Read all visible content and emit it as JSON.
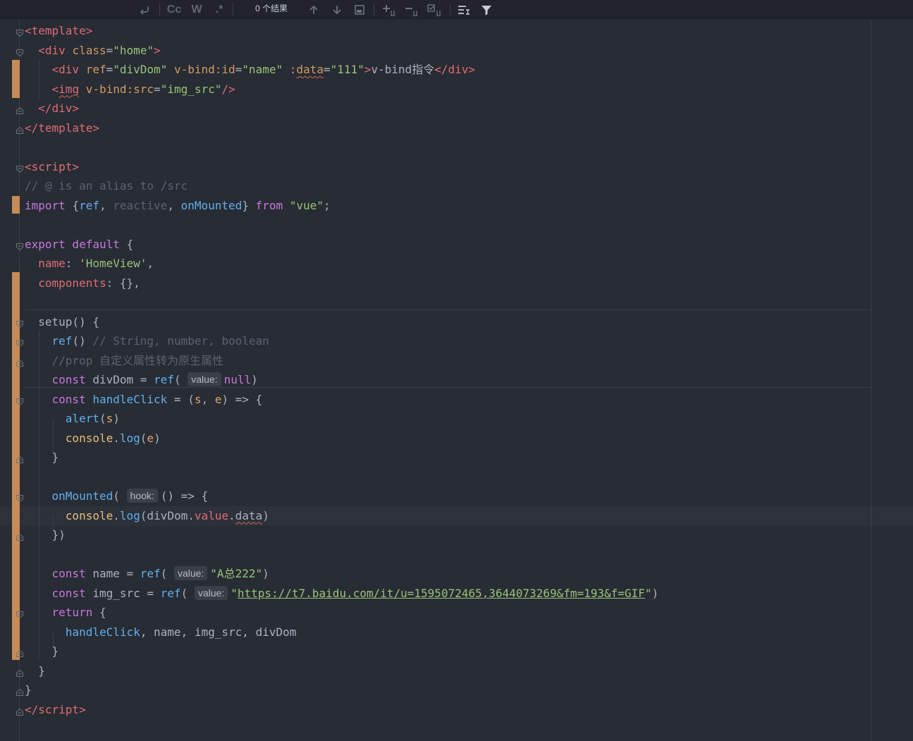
{
  "search": {
    "result_count": "0 个结果",
    "case_label": "Cc",
    "word_label": "W",
    "regex_label": ".*"
  },
  "code": [
    [
      [
        "tag",
        "<template>"
      ]
    ],
    [
      [
        "plain",
        "  "
      ],
      [
        "tag",
        "<div "
      ],
      [
        "attr",
        "class"
      ],
      [
        "plain",
        "="
      ],
      [
        "str",
        "\"home\""
      ],
      [
        "tag",
        ">"
      ]
    ],
    [
      [
        "plain",
        "    "
      ],
      [
        "tag",
        "<div "
      ],
      [
        "attr",
        "ref"
      ],
      [
        "plain",
        "="
      ],
      [
        "str",
        "\"divDom\" "
      ],
      [
        "attr",
        "v-bind:id"
      ],
      [
        "plain",
        "="
      ],
      [
        "str",
        "\"name\" "
      ],
      [
        "attr",
        ":"
      ],
      [
        "attr squig",
        "data"
      ],
      [
        "plain",
        "="
      ],
      [
        "str",
        "\"111\""
      ],
      [
        "tag",
        ">"
      ],
      [
        "plain",
        "v-bind指令"
      ],
      [
        "tag",
        "</div>"
      ]
    ],
    [
      [
        "plain",
        "    "
      ],
      [
        "tag",
        "<"
      ],
      [
        "tag squig",
        "img"
      ],
      [
        "tag",
        " "
      ],
      [
        "attr",
        "v-bind:src"
      ],
      [
        "plain",
        "="
      ],
      [
        "str",
        "\"img_src\""
      ],
      [
        "tag",
        "/>"
      ]
    ],
    [
      [
        "plain",
        "  "
      ],
      [
        "tag",
        "</div>"
      ]
    ],
    [
      [
        "tag",
        "</template>"
      ]
    ],
    [],
    [
      [
        "tag",
        "<script>"
      ]
    ],
    [
      [
        "cm",
        "// @ is an alias to /src"
      ]
    ],
    [
      [
        "kw",
        "import "
      ],
      [
        "plain",
        "{"
      ],
      [
        "fn",
        "ref"
      ],
      [
        "plain",
        ", "
      ],
      [
        "cm",
        "reactive"
      ],
      [
        "plain",
        ", "
      ],
      [
        "fn",
        "onMounted"
      ],
      [
        "plain",
        "} "
      ],
      [
        "kw",
        "from "
      ],
      [
        "str",
        "\"vue\""
      ],
      [
        "plain",
        ";"
      ]
    ],
    [],
    [
      [
        "kw",
        "export default "
      ],
      [
        "plain",
        "{"
      ]
    ],
    [
      [
        "plain",
        "  "
      ],
      [
        "tag",
        "name"
      ],
      [
        "plain",
        ": "
      ],
      [
        "str",
        "'HomeView'"
      ],
      [
        "plain",
        ","
      ]
    ],
    [
      [
        "plain",
        "  "
      ],
      [
        "tag",
        "components"
      ],
      [
        "plain",
        ": {},"
      ]
    ],
    [],
    [
      [
        "plain",
        "  setup() {"
      ]
    ],
    [
      [
        "plain",
        "    "
      ],
      [
        "fn",
        "ref"
      ],
      [
        "plain",
        "() "
      ],
      [
        "cm",
        "// String, number, boolean"
      ]
    ],
    [
      [
        "plain",
        "    "
      ],
      [
        "cm",
        "//prop 自定义属性转为原生属性"
      ]
    ],
    [
      [
        "plain",
        "    "
      ],
      [
        "kw",
        "const "
      ],
      [
        "plain",
        "divDom = "
      ],
      [
        "fn",
        "ref"
      ],
      [
        "plain",
        "( "
      ],
      [
        "hint",
        "value:"
      ],
      [
        "kw",
        "null"
      ],
      [
        "plain",
        ")"
      ]
    ],
    [
      [
        "plain",
        "    "
      ],
      [
        "kw",
        "const "
      ],
      [
        "fn",
        "handleClick"
      ],
      [
        "plain",
        " = ("
      ],
      [
        "param",
        "s"
      ],
      [
        "plain",
        ", "
      ],
      [
        "param",
        "e"
      ],
      [
        "plain",
        ") => {"
      ]
    ],
    [
      [
        "plain",
        "      "
      ],
      [
        "fn",
        "alert"
      ],
      [
        "plain",
        "("
      ],
      [
        "param",
        "s"
      ],
      [
        "plain",
        ")"
      ]
    ],
    [
      [
        "plain",
        "      "
      ],
      [
        "id",
        "console"
      ],
      [
        "plain",
        "."
      ],
      [
        "fn",
        "log"
      ],
      [
        "plain",
        "("
      ],
      [
        "param",
        "e"
      ],
      [
        "plain",
        ")"
      ]
    ],
    [
      [
        "plain",
        "    }"
      ]
    ],
    [],
    [
      [
        "plain",
        "    "
      ],
      [
        "fn",
        "onMounted"
      ],
      [
        "plain",
        "( "
      ],
      [
        "hint",
        "hook:"
      ],
      [
        "plain",
        "() => {"
      ]
    ],
    [
      [
        "plain",
        "      "
      ],
      [
        "id",
        "console"
      ],
      [
        "plain",
        "."
      ],
      [
        "fn",
        "log"
      ],
      [
        "plain",
        "(divDom."
      ],
      [
        "tag",
        "value"
      ],
      [
        "plain",
        "."
      ],
      [
        "plain squig",
        "data"
      ],
      [
        "plain",
        ")"
      ]
    ],
    [
      [
        "plain",
        "    })"
      ]
    ],
    [],
    [
      [
        "plain",
        "    "
      ],
      [
        "kw",
        "const "
      ],
      [
        "plain",
        "name = "
      ],
      [
        "fn",
        "ref"
      ],
      [
        "plain",
        "( "
      ],
      [
        "hint",
        "value:"
      ],
      [
        "str",
        "\"A总222\""
      ],
      [
        "plain",
        ")"
      ]
    ],
    [
      [
        "plain",
        "    "
      ],
      [
        "kw",
        "const "
      ],
      [
        "plain",
        "img_src = "
      ],
      [
        "fn",
        "ref"
      ],
      [
        "plain",
        "( "
      ],
      [
        "hint",
        "value:"
      ],
      [
        "str",
        "\""
      ],
      [
        "lnk",
        "https://t7.baidu.com/it/u=1595072465,3644073269&fm=193&f=GIF"
      ],
      [
        "str",
        "\""
      ],
      [
        "plain",
        ")"
      ]
    ],
    [
      [
        "plain",
        "    "
      ],
      [
        "kw",
        "return "
      ],
      [
        "plain",
        "{"
      ]
    ],
    [
      [
        "plain",
        "      "
      ],
      [
        "fn",
        "handleClick"
      ],
      [
        "plain",
        ", name, img_src, divDom"
      ]
    ],
    [
      [
        "plain",
        "    }"
      ]
    ],
    [
      [
        "plain",
        "  }"
      ]
    ],
    [
      [
        "plain",
        "}"
      ]
    ],
    [
      [
        "tag",
        "</"
      ],
      [
        "tag",
        "script"
      ],
      [
        "tag",
        ">"
      ]
    ]
  ]
}
